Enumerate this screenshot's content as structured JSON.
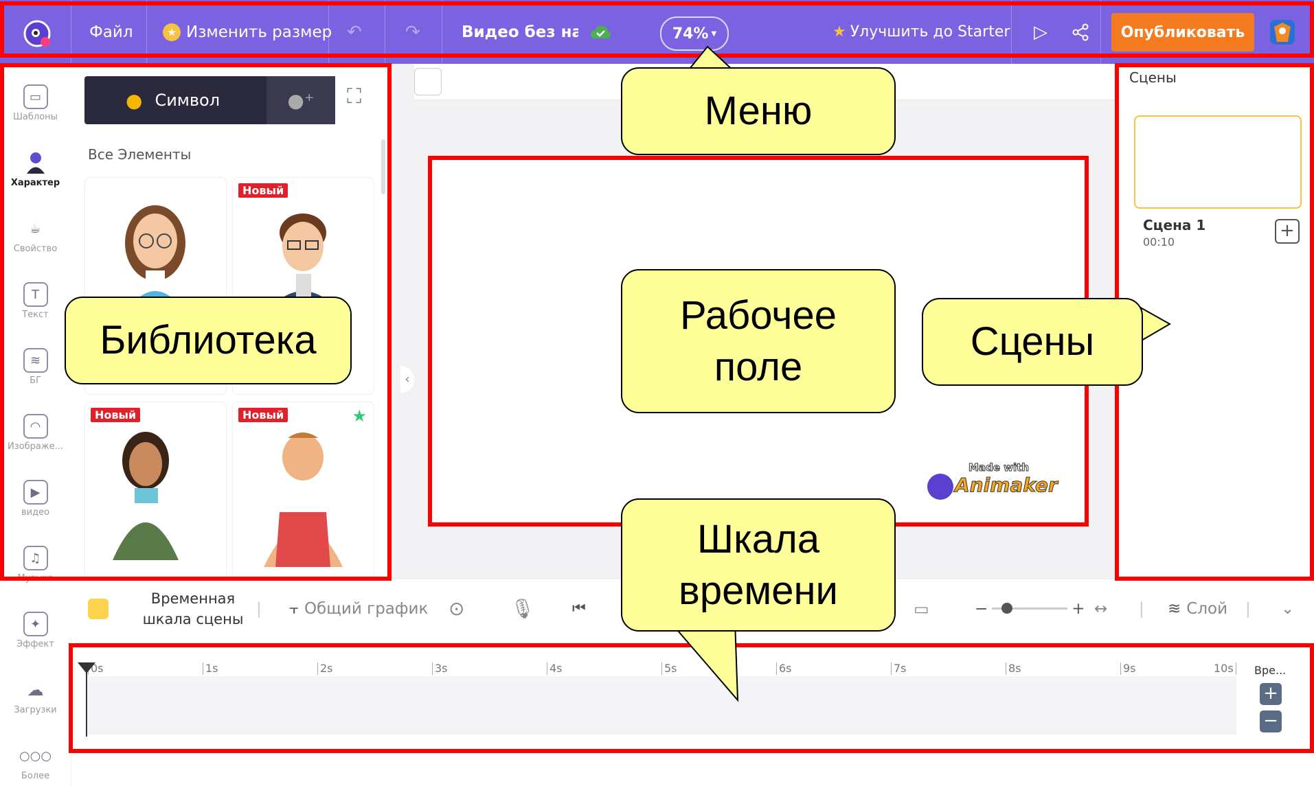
{
  "topbar": {
    "file": "Файл",
    "resize": "Изменить размер",
    "video_title": "Видео без назва",
    "zoom": "74%",
    "upgrade": "Улучшить до Starter",
    "publish": "Опубликовать",
    "bg_color": "#7a62e0",
    "publish_color": "#f47b20"
  },
  "rail": {
    "items": [
      {
        "label": "Шаблоны",
        "icon": "templates-icon"
      },
      {
        "label": "Характер",
        "icon": "character-icon"
      },
      {
        "label": "Свойство",
        "icon": "property-icon"
      },
      {
        "label": "Текст",
        "icon": "text-icon"
      },
      {
        "label": "БГ",
        "icon": "background-icon"
      },
      {
        "label": "Изображе...",
        "icon": "image-icon"
      },
      {
        "label": "видео",
        "icon": "video-icon"
      },
      {
        "label": "Музыка",
        "icon": "music-icon"
      },
      {
        "label": "Эффект",
        "icon": "effect-icon"
      },
      {
        "label": "Загрузки",
        "icon": "upload-icon"
      },
      {
        "label": "Более",
        "icon": "more-icon"
      }
    ]
  },
  "library": {
    "tab_symbol": "Символ",
    "heading": "Все Элементы",
    "badge_new": "Новый"
  },
  "scenes": {
    "title": "Сцены",
    "scene1_name": "Сцена 1",
    "scene1_duration": "00:10"
  },
  "canvas": {
    "watermark_top": "Made with",
    "watermark_brand": "Animaker"
  },
  "timeline_toolbar": {
    "scene_timeline": "Временная шкала сцены",
    "general_schedule": "Общий график",
    "layer": "Слой"
  },
  "timeline": {
    "ticks": [
      "0s",
      "1s",
      "2s",
      "3s",
      "4s",
      "5s",
      "6s",
      "7s",
      "8s",
      "9s",
      "10s"
    ],
    "time_label": "Вре..."
  },
  "callouts": {
    "menu": "Меню",
    "library": "Библиотека",
    "workspace_line1": "Рабочее",
    "workspace_line2": "поле",
    "scenes": "Сцены",
    "timeline_line1": "Шкала",
    "timeline_line2": "времени"
  }
}
